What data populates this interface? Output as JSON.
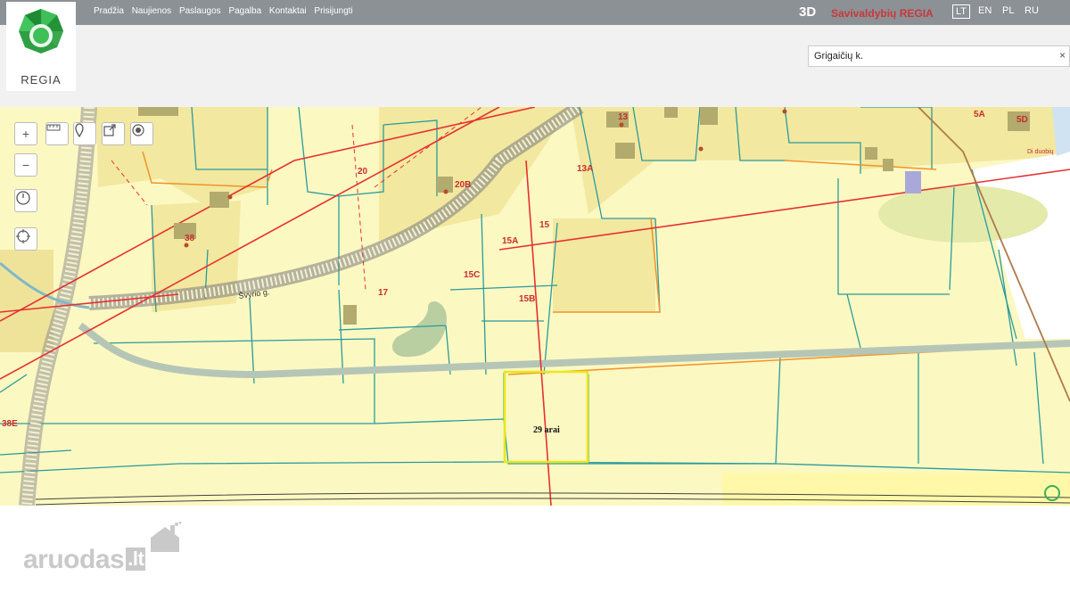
{
  "nav": {
    "items": [
      "Pradžia",
      "Naujienos",
      "Paslaugos",
      "Pagalba",
      "Kontaktai",
      "Prisijungti"
    ],
    "btn3d": "3D",
    "brand": "Savivaldybių REGIA",
    "languages": [
      "LT",
      "EN",
      "PL",
      "RU"
    ],
    "active_language": "LT"
  },
  "logo": {
    "text": "REGIA"
  },
  "search": {
    "value": "Grigaičių k.",
    "clear_icon": "close-icon"
  },
  "map_tools": {
    "zoom_in": "+",
    "zoom_out": "−",
    "icons": [
      "ruler-icon",
      "pin-icon",
      "share-icon",
      "target-icon",
      "clock-icon",
      "crosshair-icon"
    ]
  },
  "map": {
    "parcel_labels": [
      "20",
      "20B",
      "13",
      "13A",
      "15",
      "15A",
      "15C",
      "15B",
      "17",
      "38",
      "38E",
      "5A",
      "5D"
    ],
    "road_label": "Švyrio g.",
    "selected_parcel_label": "29 arai",
    "corner_label": "Di duobių"
  },
  "footer": {
    "watermark": "aruodas",
    "watermark_suffix": ".lt"
  }
}
